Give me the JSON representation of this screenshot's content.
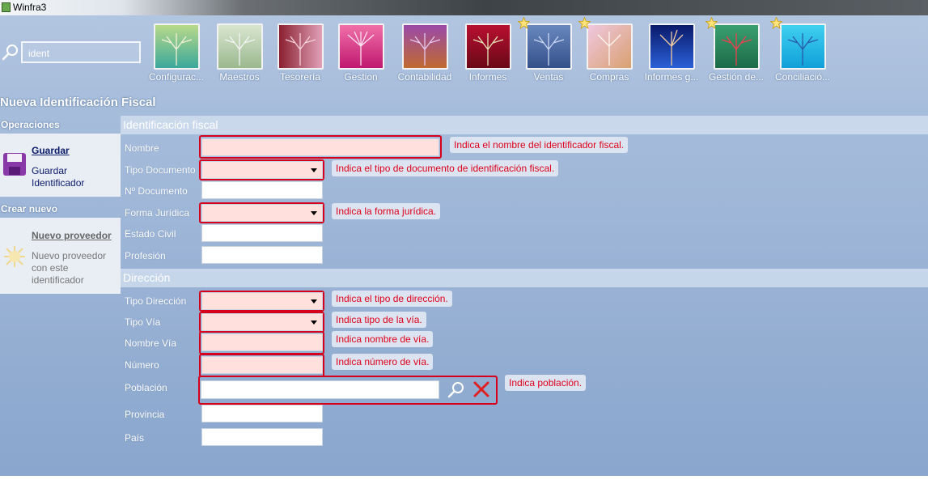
{
  "window": {
    "title": "Winfra3"
  },
  "search": {
    "value": "ident"
  },
  "modules": [
    {
      "label": "Configurac...",
      "starred": false
    },
    {
      "label": "Maestros",
      "starred": false
    },
    {
      "label": "Tesorería",
      "starred": false
    },
    {
      "label": "Gestion",
      "starred": false
    },
    {
      "label": "Contabilidad",
      "starred": false
    },
    {
      "label": "Informes",
      "starred": false
    },
    {
      "label": "Ventas",
      "starred": true
    },
    {
      "label": "Compras",
      "starred": true
    },
    {
      "label": "Informes g...",
      "starred": false
    },
    {
      "label": "Gestión de...",
      "starred": true
    },
    {
      "label": "Conciliació...",
      "starred": true
    }
  ],
  "page": {
    "title": "Nueva Identificación Fiscal"
  },
  "left": {
    "operaciones": {
      "header": "Operaciones",
      "title": "Guardar",
      "description_line1": "Guardar",
      "description_line2": "Identificador"
    },
    "crear_nuevo": {
      "header": "Crear nuevo",
      "title": "Nuevo proveedor",
      "description_line1": "Nuevo proveedor",
      "description_line2": "con este",
      "description_line3": "identificador"
    }
  },
  "form": {
    "section_fiscal": "Identificación fiscal",
    "section_direccion": "Dirección",
    "labels": {
      "nombre": "Nombre",
      "tipo_documento": "Tipo Documento",
      "n_documento": "Nº Documento",
      "forma_juridica": "Forma Jurídica",
      "estado_civil": "Estado Civil",
      "profesion": "Profesión",
      "tipo_direccion": "Tipo Dirección",
      "tipo_via": "Tipo Vía",
      "nombre_via": "Nombre Vía",
      "numero": "Número",
      "poblacion": "Población",
      "provincia": "Provincia",
      "pais": "País"
    },
    "tips": {
      "nombre": "Indica el nombre del identificador fiscal.",
      "tipo_documento": "Indica el tipo de documento de identificación fiscal.",
      "forma_juridica": "Indica la forma jurídica.",
      "tipo_direccion": "Indica el tipo de dirección.",
      "tipo_via": "Indica tipo de la vía.",
      "nombre_via": "Indica nombre de vía.",
      "numero": "Indica número de vía.",
      "poblacion": "Indica población."
    }
  },
  "colors": {
    "required_bg": "#ffe0dc",
    "highlight_border": "#d6001c",
    "tip_text": "#e0001b"
  }
}
